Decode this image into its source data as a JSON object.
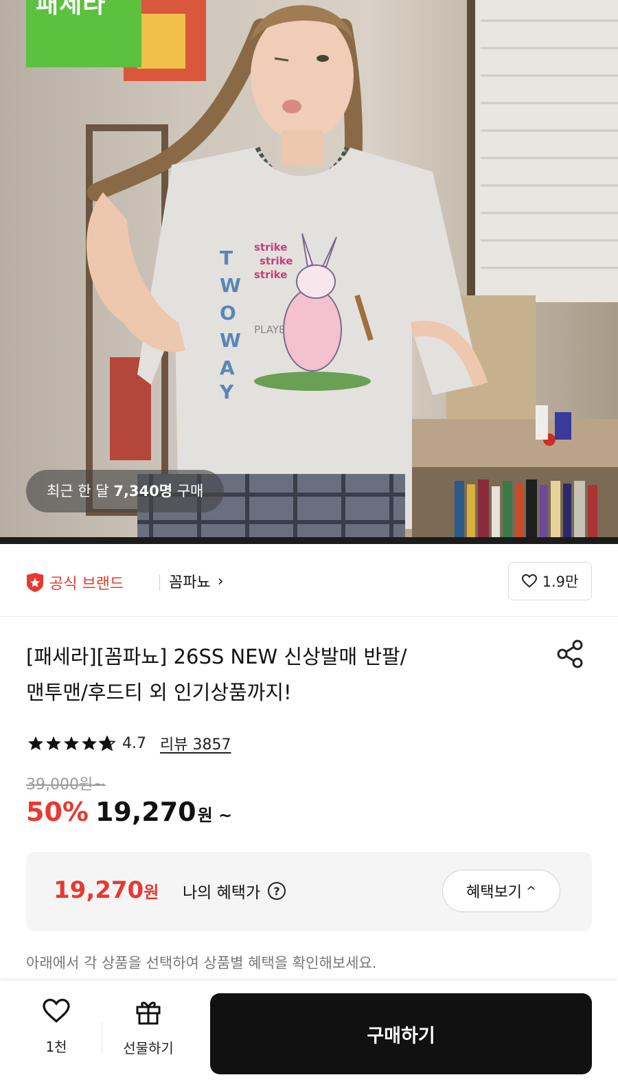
{
  "hero": {
    "brand_tag": "패세라",
    "purchase_prefix": "최근 한 달 ",
    "purchase_count": "7,340명",
    "purchase_suffix": " 구매"
  },
  "brand": {
    "official_label": "공식 브랜드",
    "brand_name": "꼼파뇨",
    "like_count": "1.9만"
  },
  "product": {
    "title_line1": "[패세라][꼼파뇨] 26SS NEW 신상발매 반팔/",
    "title_line2": "맨투맨/후드티 외 인기상품까지!",
    "rating": "4.7",
    "rating_stars": 4.7,
    "review_label": "리뷰 3857",
    "original_price": "39,000원~",
    "discount": "50%",
    "sale_price": "19,270",
    "sale_unit": "원 ~"
  },
  "benefit": {
    "price": "19,270",
    "unit": "원",
    "label": "나의 혜택가",
    "button": "혜택보기"
  },
  "hint": "아래에서 각 상품을 선택하여 상품별 혜택을 확인해보세요.",
  "bottom_bar": {
    "wish_count": "1천",
    "gift_label": "선물하기",
    "buy_label": "구매하기"
  },
  "colors": {
    "accent_red": "#e8392f",
    "brand_green": "#5bc13e",
    "buy_button": "#111111"
  }
}
